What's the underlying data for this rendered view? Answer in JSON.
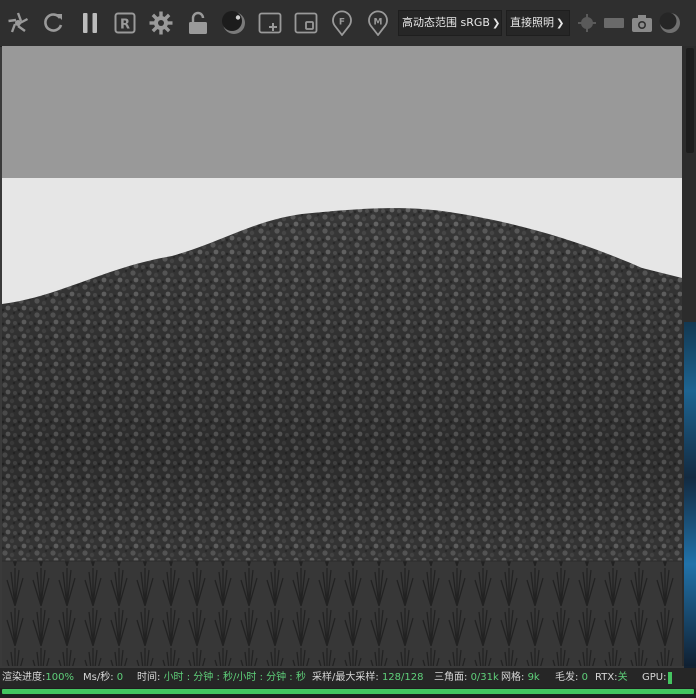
{
  "toolbar": {
    "buttons": [
      {
        "icon": "aperture-icon"
      },
      {
        "icon": "refresh-icon"
      },
      {
        "icon": "pause-icon"
      },
      {
        "icon": "region-r-icon"
      },
      {
        "icon": "gear-icon"
      },
      {
        "icon": "unlock-icon"
      },
      {
        "icon": "sphere-icon"
      },
      {
        "icon": "add-region-icon"
      },
      {
        "icon": "crop-region-icon"
      },
      {
        "icon": "focus-pin-icon"
      },
      {
        "icon": "material-pin-icon"
      }
    ],
    "color_space": {
      "label": "高动态范围 sRGB"
    },
    "lighting_mode": {
      "label": "直接照明"
    },
    "right_buttons": [
      {
        "icon": "dot-icon"
      },
      {
        "icon": "rect-icon"
      },
      {
        "icon": "camera-icon"
      },
      {
        "icon": "sphere-small-icon"
      }
    ]
  },
  "status": {
    "progress_label": "渲染进度:",
    "progress_value": "100%",
    "progress_fraction": 1.0,
    "ms_label": "Ms/秒:",
    "ms_value": "0",
    "time_label": "时间:",
    "time_value": "小时 : 分钟 : 秒/小时 : 分钟 : 秒",
    "samples_label": "采样/最大采样:",
    "samples_value": "128/128",
    "tris_label": "三角面:",
    "tris_value": "0/31k",
    "mesh_label": "网格:",
    "mesh_value": "9k",
    "hair_label": "毛发:",
    "hair_value": "0",
    "rtx_label": "RTX:",
    "rtx_value": "关",
    "gpu_label": "GPU:"
  },
  "colors": {
    "accent_green": "#44c560",
    "status_value": "#5fd07a",
    "toolbar_bg": "#2f2f2f"
  }
}
